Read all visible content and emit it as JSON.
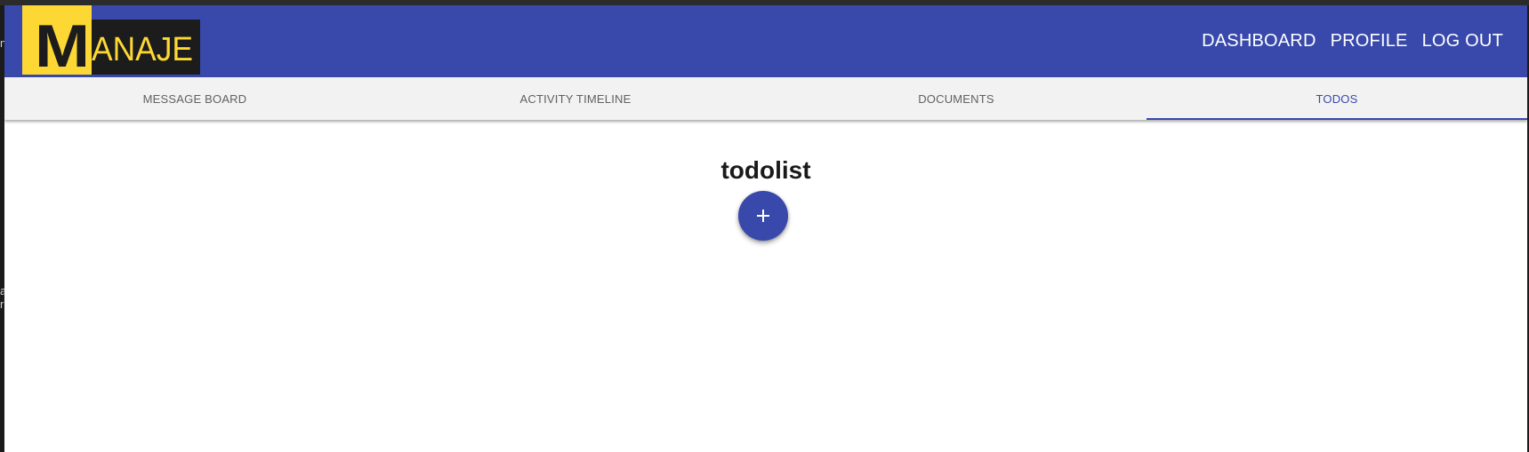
{
  "logo": {
    "text_first": "M",
    "text_rest": "ANAJE",
    "colors": {
      "yellow": "#fdd835",
      "dark": "#1c1c1c"
    }
  },
  "nav": {
    "items": [
      {
        "label": "DASHBOARD"
      },
      {
        "label": "PROFILE"
      },
      {
        "label": "LOG OUT"
      }
    ]
  },
  "tabs": {
    "items": [
      {
        "label": "MESSAGE BOARD",
        "active": false
      },
      {
        "label": "ACTIVITY TIMELINE",
        "active": false
      },
      {
        "label": "DOCUMENTS",
        "active": false
      },
      {
        "label": "TODOS",
        "active": true
      }
    ]
  },
  "main": {
    "title": "todolist",
    "add_button_icon": "plus-icon"
  },
  "theme": {
    "primary": "#3949ab",
    "tab_bar_bg": "#f2f2f2",
    "tab_text": "#616161"
  }
}
